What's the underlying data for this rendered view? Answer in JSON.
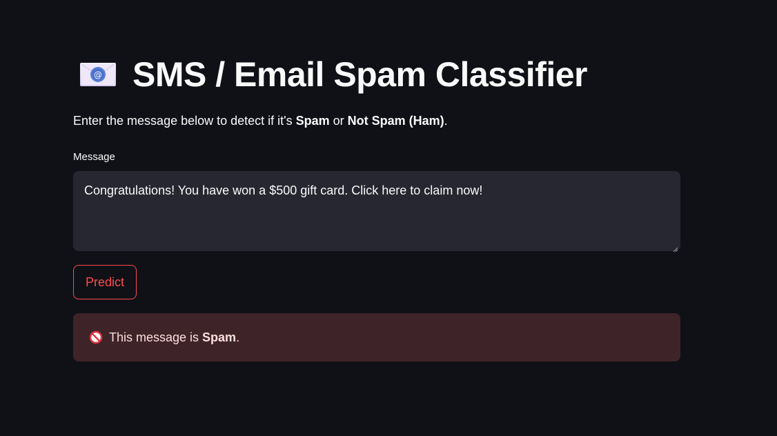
{
  "header": {
    "title": "SMS / Email Spam Classifier",
    "icon": "email-envelope-icon"
  },
  "intro": {
    "text_before": "Enter the message below to detect if it's ",
    "spam_bold": "Spam",
    "text_or": " or ",
    "ham_bold": "Not Spam (Ham)",
    "text_after": "."
  },
  "message_field": {
    "label": "Message",
    "value": "Congratulations! You have won a $500 gift card. Click here to claim now!"
  },
  "predict_button": {
    "label": "Predict"
  },
  "result": {
    "icon": "no-entry-icon",
    "text_before": "This message is ",
    "verdict": "Spam",
    "text_after": "."
  },
  "colors": {
    "background": "#0f1117",
    "accent": "#ff4b4b",
    "input_bg": "#262730",
    "error_bg": "#3e2428"
  }
}
